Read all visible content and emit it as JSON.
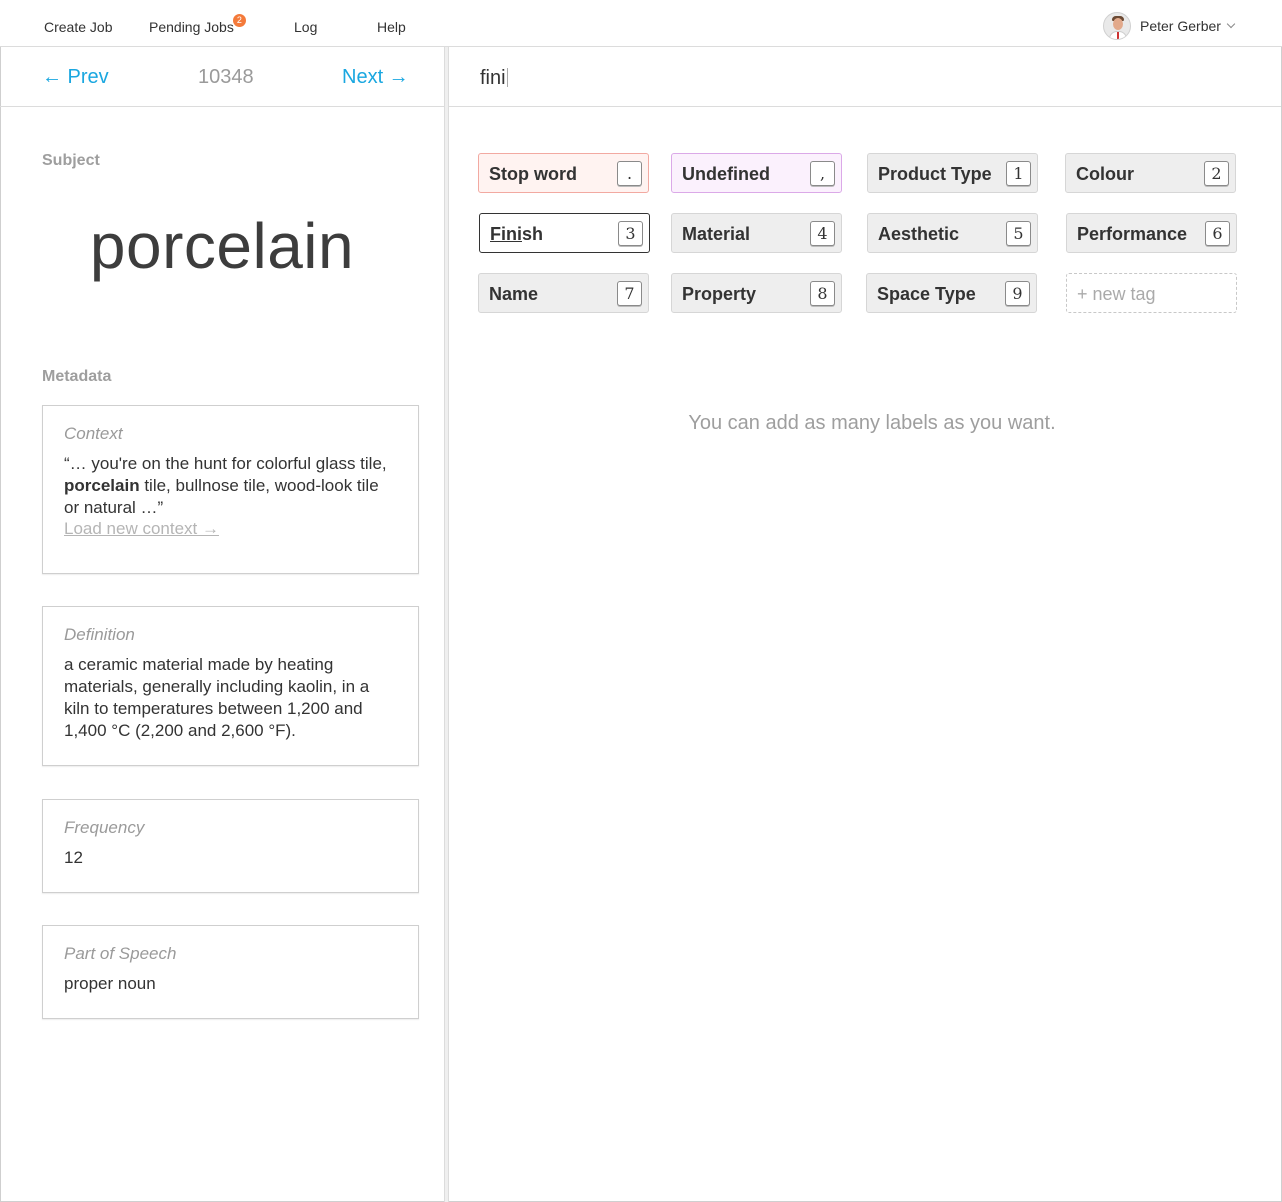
{
  "nav": {
    "items": [
      "Create Job",
      "Pending Jobs",
      "Log",
      "Help"
    ],
    "pending_badge": "2",
    "user_name": "Peter Gerber"
  },
  "pager": {
    "prev": "← Prev",
    "id": "10348",
    "next": "Next →"
  },
  "subject": {
    "label": "Subject",
    "value": "porcelain"
  },
  "metadata": {
    "label": "Metadata",
    "context": {
      "title": "Context",
      "before": "“… you're on the hunt for colorful glass tile, ",
      "highlight": "porcelain",
      "after": " tile, bullnose tile, wood-look tile or natural …”",
      "link": "Load new context →"
    },
    "definition": {
      "title": "Definition",
      "text": "a ceramic material made by heating materials, generally including kaolin, in a kiln to temperatures between 1,200 and 1,400 °C (2,200 and 2,600 °F)."
    },
    "frequency": {
      "title": "Frequency",
      "value": "12"
    },
    "pos": {
      "title": "Part of Speech",
      "value": "proper noun"
    }
  },
  "search": {
    "value": "fini"
  },
  "tags": [
    {
      "label": "Stop word",
      "key": "."
    },
    {
      "label": "Undefined",
      "key": ","
    },
    {
      "label": "Product Type",
      "key": "1"
    },
    {
      "label": "Colour",
      "key": "2"
    },
    {
      "label_match": "Fini",
      "label_rest": "sh",
      "key": "3"
    },
    {
      "label": "Material",
      "key": "4"
    },
    {
      "label": "Aesthetic",
      "key": "5"
    },
    {
      "label": "Performance",
      "key": "6"
    },
    {
      "label": "Name",
      "key": "7"
    },
    {
      "label": "Property",
      "key": "8"
    },
    {
      "label": "Space Type",
      "key": "9"
    },
    {
      "label": "+ new tag"
    }
  ],
  "hint": "You can add as many labels as you want.",
  "colors": {
    "accent": "#1aa7e0",
    "badge": "#f47a3a",
    "stop_bg": "#fff3f1",
    "undefined_bg": "#fbf1fd"
  }
}
